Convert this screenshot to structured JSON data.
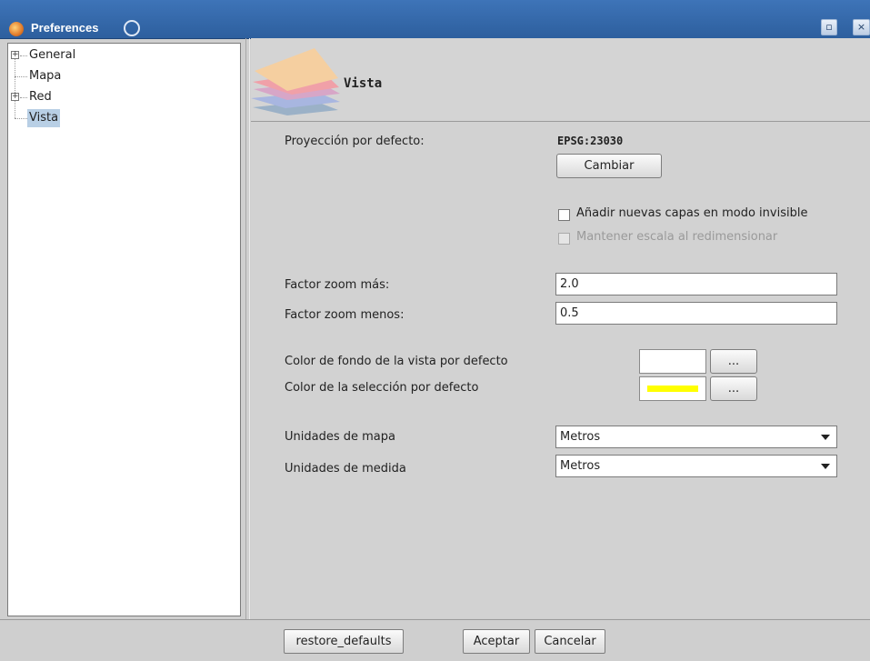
{
  "window": {
    "title": "Preferences"
  },
  "tree": {
    "items": [
      {
        "label": "General",
        "expandable": true,
        "selected": false
      },
      {
        "label": "Mapa",
        "expandable": false,
        "selected": false
      },
      {
        "label": "Red",
        "expandable": true,
        "selected": false
      },
      {
        "label": "Vista",
        "expandable": false,
        "selected": true
      }
    ]
  },
  "panel": {
    "title": "Vista",
    "projection_label": "Proyección por defecto:",
    "projection_value": "EPSG:23030",
    "change_button": "Cambiar",
    "invisible_layers_label": "Añadir nuevas capas en modo invisible",
    "invisible_layers_checked": false,
    "keep_scale_label": "Mantener escala al redimensionar",
    "keep_scale_checked": false,
    "keep_scale_enabled": false,
    "zoom_in_label": "Factor zoom más:",
    "zoom_in_value": "2.0",
    "zoom_out_label": "Factor zoom menos:",
    "zoom_out_value": "0.5",
    "bg_color_label": "Color de fondo de la vista por defecto",
    "bg_color": "#ffffff",
    "selection_color_label": "Color de la selección por defecto",
    "selection_color": "#ffff00",
    "color_button_label": "...",
    "map_units_label": "Unidades de mapa",
    "map_units_value": "Metros",
    "measure_units_label": "Unidades de medida",
    "measure_units_value": "Metros"
  },
  "buttons": {
    "restore": "restore_defaults",
    "accept": "Aceptar",
    "cancel": "Cancelar"
  },
  "colors": {
    "titlebar": "#2d5f9e",
    "selection_highlight": "#b8cfe5"
  }
}
